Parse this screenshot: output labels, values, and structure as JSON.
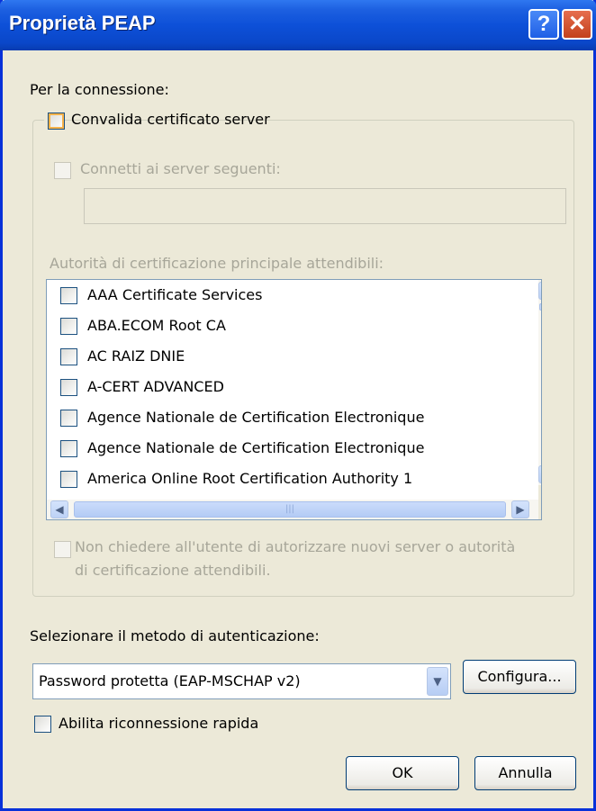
{
  "window": {
    "title": "Proprietà PEAP",
    "help_label": "?",
    "close_label": "✕"
  },
  "connection": {
    "heading": "Per la connessione:",
    "validate_cert_label": "Convalida certificato server",
    "validate_cert_checked": false,
    "connect_servers_label": "Connetti ai server seguenti:",
    "connect_servers_checked": false,
    "servers_value": "",
    "ca_heading": "Autorità di certificazione principale attendibili:",
    "ca_list": [
      {
        "label": "AAA Certificate Services",
        "checked": false
      },
      {
        "label": "ABA.ECOM Root CA",
        "checked": false
      },
      {
        "label": "AC RAIZ DNIE",
        "checked": false
      },
      {
        "label": "A-CERT ADVANCED",
        "checked": false
      },
      {
        "label": "Agence Nationale de Certification Electronique",
        "checked": false
      },
      {
        "label": "Agence Nationale de Certification Electronique",
        "checked": false
      },
      {
        "label": "America Online Root Certification Authority 1",
        "checked": false
      }
    ],
    "no_prompt_label_line1": "Non chiedere all'utente di autorizzare nuovi server o autorità",
    "no_prompt_label_line2": "di certificazione attendibili.",
    "no_prompt_checked": false
  },
  "auth": {
    "heading": "Selezionare il metodo di autenticazione:",
    "method_value": "Password protetta (EAP-MSCHAP v2)",
    "configure_label": "Configura...",
    "fast_reconnect_label": "Abilita riconnessione rapida",
    "fast_reconnect_checked": false
  },
  "footer": {
    "ok_label": "OK",
    "cancel_label": "Annulla"
  },
  "icons": {
    "scroll_up": "▲",
    "scroll_down": "▼",
    "scroll_left": "◀",
    "scroll_right": "▶",
    "thumb_grip": "|||",
    "combo_arrow": "▼"
  },
  "colors": {
    "titlebar": "#0a47c9",
    "dialog_bg": "#ece9d8",
    "disabled_text": "#a7a699"
  }
}
